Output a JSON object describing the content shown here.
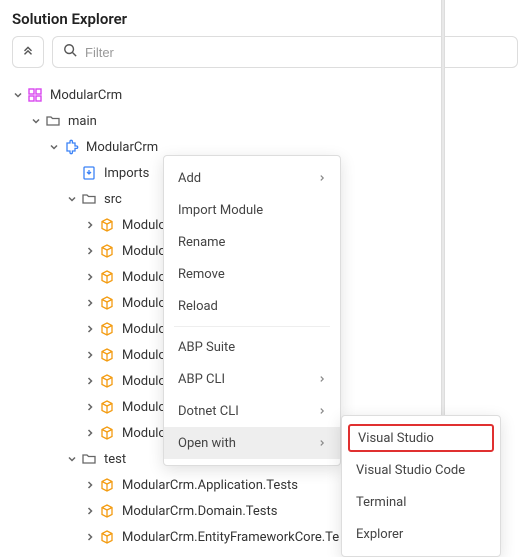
{
  "panel": {
    "title": "Solution Explorer"
  },
  "search": {
    "placeholder": "Filter"
  },
  "tree": {
    "root": {
      "label": "ModularCrm"
    },
    "main": {
      "label": "main"
    },
    "solution": {
      "label": "ModularCrm"
    },
    "imports": {
      "label": "Imports"
    },
    "src": {
      "label": "src"
    },
    "test": {
      "label": "test"
    },
    "srcItems": [
      "Modulo",
      "Modulo",
      "Modulo",
      "Modulo",
      "Modulo",
      "Modulo",
      "Modulo",
      "Modulo",
      "Modulo"
    ],
    "testItems": [
      "ModularCrm.Application.Tests",
      "ModularCrm.Domain.Tests",
      "ModularCrm.EntityFrameworkCore.Te"
    ]
  },
  "contextMenu": {
    "add": "Add",
    "importModule": "Import Module",
    "rename": "Rename",
    "remove": "Remove",
    "reload": "Reload",
    "abpSuite": "ABP Suite",
    "abpCli": "ABP CLI",
    "dotnetCli": "Dotnet CLI",
    "openWith": "Open with"
  },
  "submenu": {
    "visualStudio": "Visual Studio",
    "visualStudioCode": "Visual Studio Code",
    "terminal": "Terminal",
    "explorer": "Explorer"
  },
  "colors": {
    "highlight": "#e03030",
    "moduleIcon": "#f39c12",
    "solutionIcon": "#3b82f6",
    "importsIcon": "#3b82f6",
    "rootIcon": "#d946ef"
  }
}
